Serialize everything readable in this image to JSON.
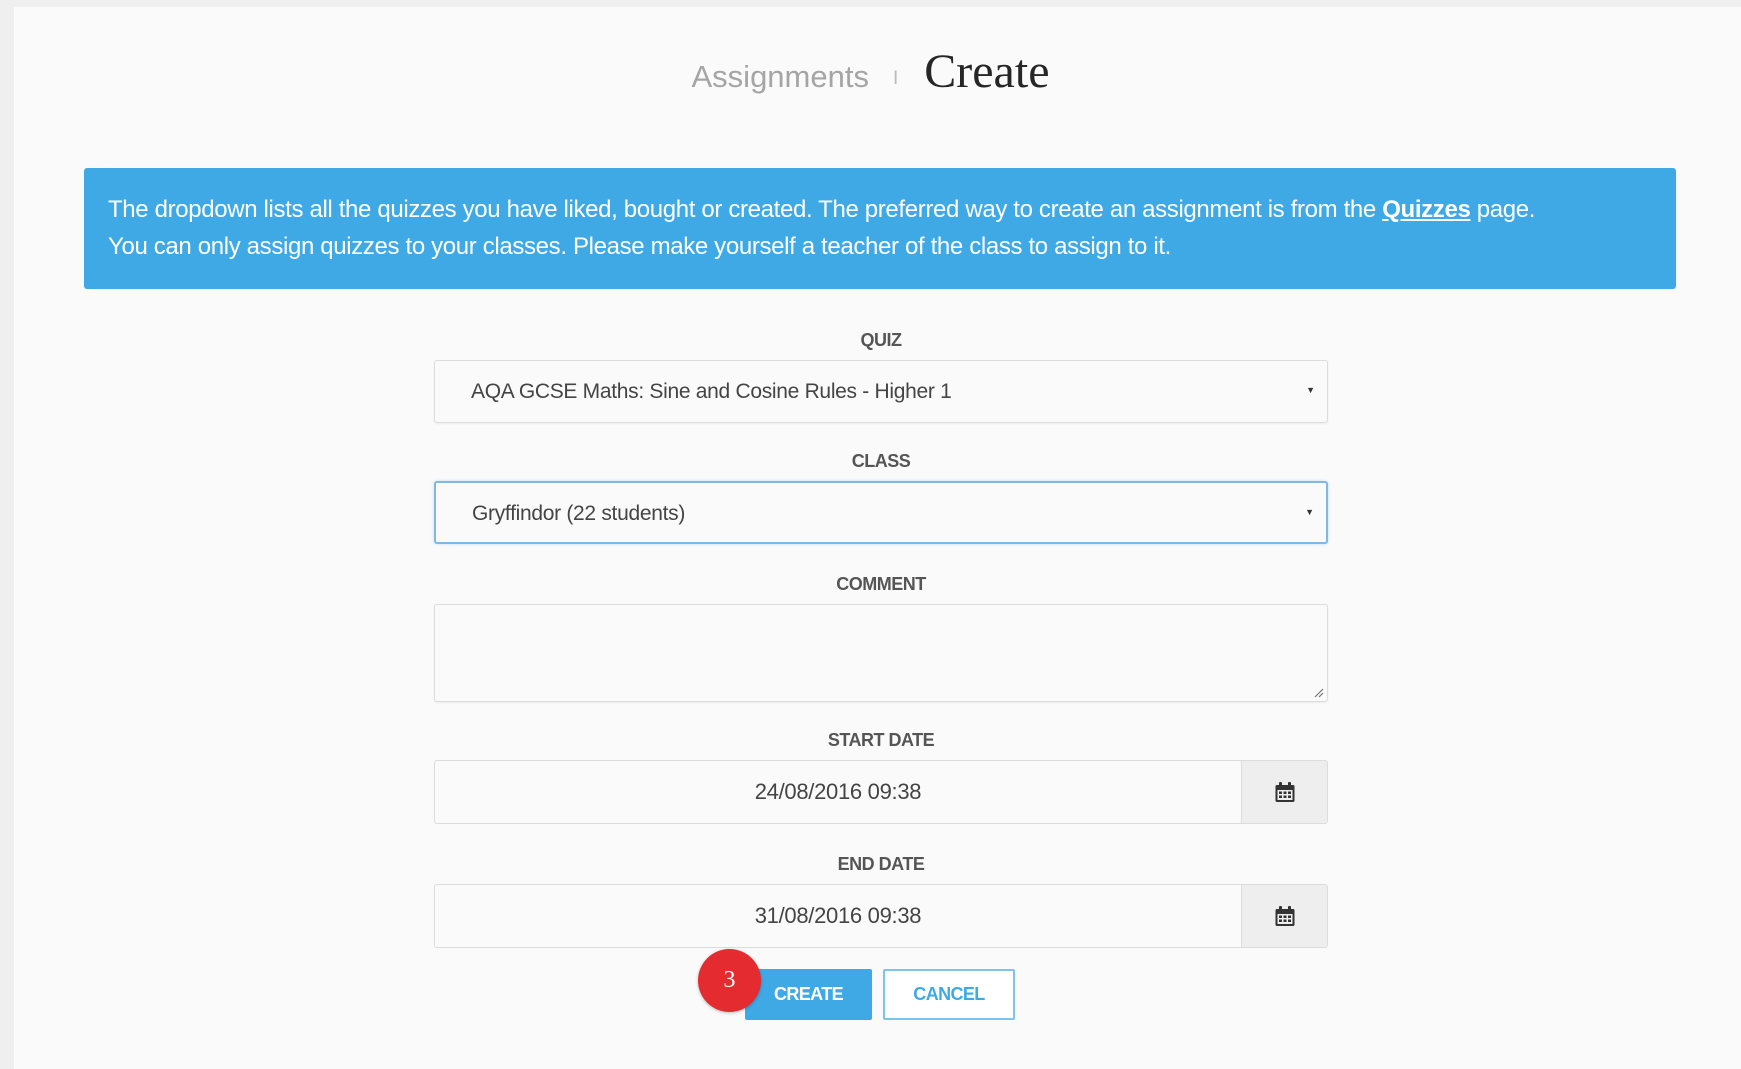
{
  "breadcrumb": {
    "parent": "Assignments",
    "separator": "I",
    "current": "Create"
  },
  "info": {
    "line1_text": "The dropdown lists all the quizzes you have liked, bought or created. The preferred way to create an assignment is from the ",
    "link": "Quizzes",
    "line1_end": " page.",
    "line2": "You can only assign quizzes to your classes. Please make yourself a teacher of the class to assign to it."
  },
  "form": {
    "quiz_label": "QUIZ",
    "quiz_value": "AQA GCSE Maths: Sine and Cosine Rules - Higher 1",
    "class_label": "CLASS",
    "class_value": "Gryffindor (22 students)",
    "comment_label": "COMMENT",
    "comment_value": "",
    "start_label": "START DATE",
    "start_value": "24/08/2016 09:38",
    "end_label": "END DATE",
    "end_value": "31/08/2016 09:38",
    "dropdown_arrow": "▼",
    "calendar_icon": "calendar-icon"
  },
  "actions": {
    "create_label": "CREATE",
    "cancel_label": "CANCEL"
  },
  "annotation": {
    "step_number": "3"
  },
  "colors": {
    "accent": "#3fa9e6",
    "badge": "#e42b30",
    "background": "#fafafa"
  }
}
